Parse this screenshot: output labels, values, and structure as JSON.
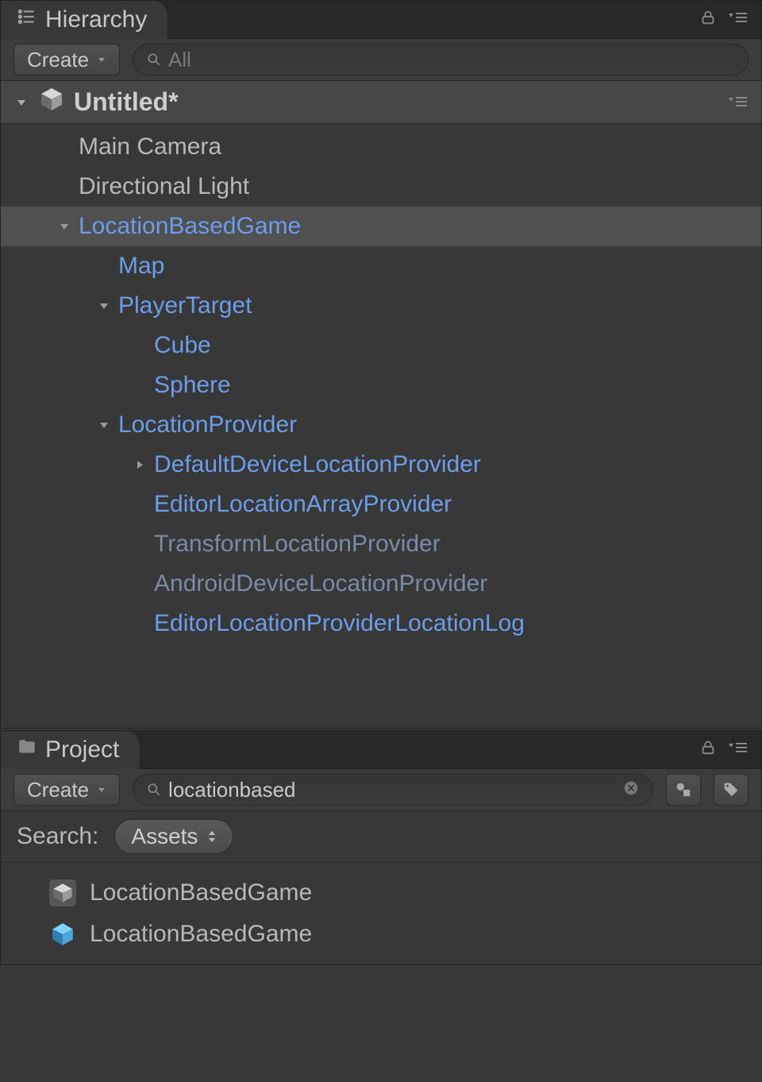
{
  "hierarchy": {
    "tab_label": "Hierarchy",
    "create_label": "Create",
    "search_placeholder": "All",
    "scene_title": "Untitled*",
    "items": [
      {
        "label": "Main Camera",
        "indent": 100,
        "prefab": false,
        "selected": false,
        "fold": "none"
      },
      {
        "label": "Directional Light",
        "indent": 100,
        "prefab": false,
        "selected": false,
        "fold": "none"
      },
      {
        "label": "LocationBasedGame",
        "indent": 100,
        "prefab": true,
        "selected": true,
        "fold": "down"
      },
      {
        "label": "Map",
        "indent": 150,
        "prefab": true,
        "selected": false,
        "fold": "none"
      },
      {
        "label": "PlayerTarget",
        "indent": 150,
        "prefab": true,
        "selected": false,
        "fold": "down"
      },
      {
        "label": "Cube",
        "indent": 195,
        "prefab": true,
        "selected": false,
        "fold": "none"
      },
      {
        "label": "Sphere",
        "indent": 195,
        "prefab": true,
        "selected": false,
        "fold": "none"
      },
      {
        "label": "LocationProvider",
        "indent": 150,
        "prefab": true,
        "selected": false,
        "fold": "down"
      },
      {
        "label": "DefaultDeviceLocationProvider",
        "indent": 195,
        "prefab": true,
        "selected": false,
        "fold": "right"
      },
      {
        "label": "EditorLocationArrayProvider",
        "indent": 195,
        "prefab": true,
        "selected": false,
        "fold": "none"
      },
      {
        "label": "TransformLocationProvider",
        "indent": 195,
        "prefab": true,
        "selected": false,
        "fold": "none",
        "dim": true
      },
      {
        "label": "AndroidDeviceLocationProvider",
        "indent": 195,
        "prefab": true,
        "selected": false,
        "fold": "none",
        "dim": true
      },
      {
        "label": "EditorLocationProviderLocationLog",
        "indent": 195,
        "prefab": true,
        "selected": false,
        "fold": "none"
      }
    ]
  },
  "project": {
    "tab_label": "Project",
    "create_label": "Create",
    "search_value": "locationbased",
    "search_label": "Search:",
    "filter_pill": "Assets",
    "results": [
      {
        "label": "LocationBasedGame",
        "icon": "unity"
      },
      {
        "label": "LocationBasedGame",
        "icon": "prefab"
      }
    ]
  }
}
